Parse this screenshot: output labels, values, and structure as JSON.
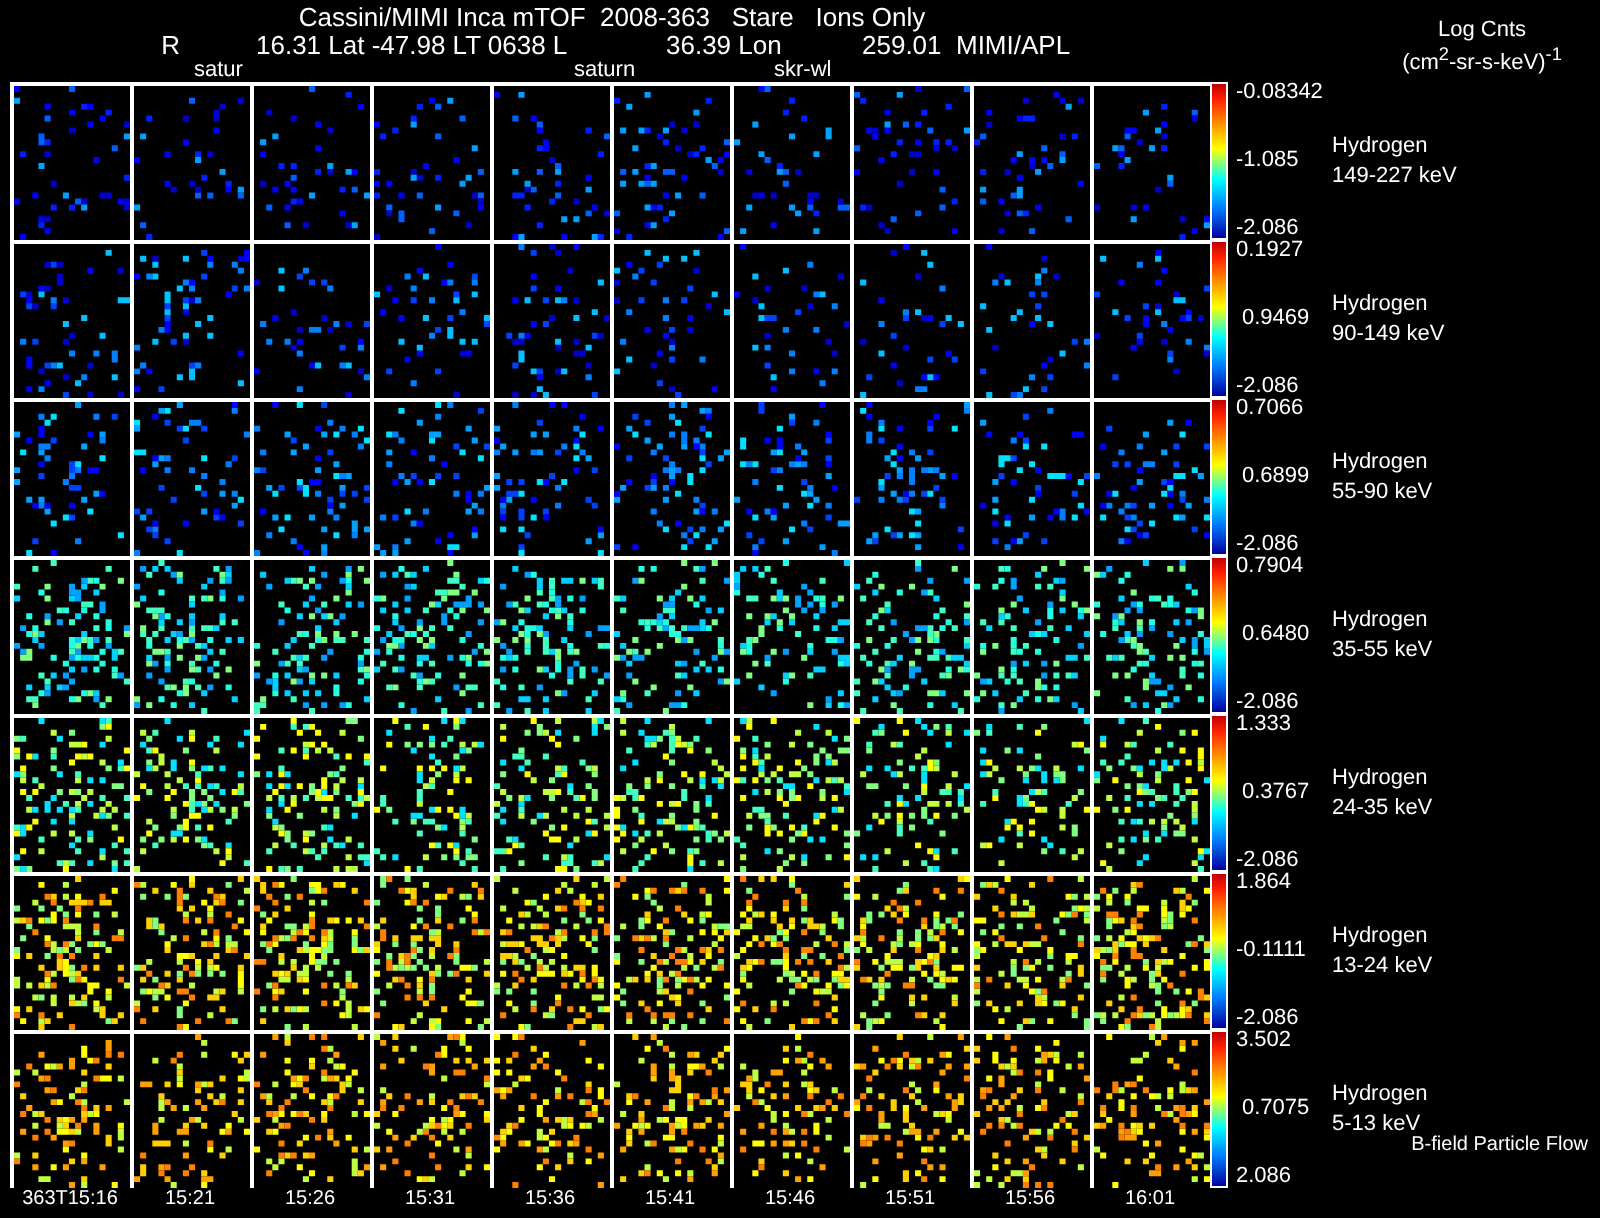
{
  "title": "Cassini/MIMI Inca mTOF  2008-363   Stare   Ions Only",
  "orbit_info": [
    "R",
    "16.31 Lat -47.98 LT 0638 L",
    "36.39 Lon",
    "259.01  MIMI/APL"
  ],
  "target_labels": [
    "satur",
    "saturn",
    "skr-wl"
  ],
  "units": {
    "line_1": "Log Cnts",
    "line_2": "(cm$^{2}$-sr-s-keV)$^{-1}$"
  },
  "rows": [
    {
      "species": "Hydrogen",
      "energy": "149-227 keV",
      "scale_max": "-0.08342",
      "scale_mid": "-1.085",
      "scale_min": "-2.086"
    },
    {
      "species": "Hydrogen",
      "energy": "90-149 keV",
      "scale_max": "0.1927",
      "scale_mid": "0.9469",
      "scale_min": "-2.086"
    },
    {
      "species": "Hydrogen",
      "energy": "55-90 keV",
      "scale_max": "0.7066",
      "scale_mid": "0.6899",
      "scale_min": "-2.086"
    },
    {
      "species": "Hydrogen",
      "energy": "35-55 keV",
      "scale_max": "0.7904",
      "scale_mid": "0.6480",
      "scale_min": "-2.086"
    },
    {
      "species": "Hydrogen",
      "energy": "24-35 keV",
      "scale_max": "1.333",
      "scale_mid": "0.3767",
      "scale_min": "-2.086"
    },
    {
      "species": "Hydrogen",
      "energy": "13-24 keV",
      "scale_max": "1.864",
      "scale_mid": "-0.1111",
      "scale_min": "-2.086"
    },
    {
      "species": "Hydrogen",
      "energy": "5-13 keV",
      "scale_max": "3.502",
      "scale_mid": "0.7075",
      "scale_min": "2.086"
    }
  ],
  "times": [
    "363T15:16",
    "15:21",
    "15:26",
    "15:31",
    "15:36",
    "15:41",
    "15:46",
    "15:51",
    "15:56",
    "16:01"
  ],
  "footnote": "B-field Particle Flow"
}
